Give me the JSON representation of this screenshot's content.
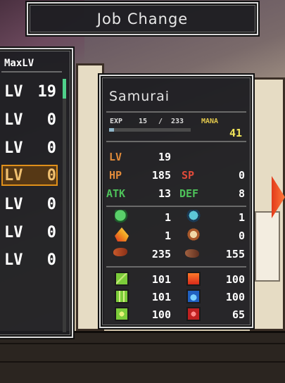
{
  "title_bar": {
    "title": "Job Change"
  },
  "level_list": {
    "header": "MaxLV",
    "rows": [
      {
        "tag": "LV",
        "value": "19"
      },
      {
        "tag": "LV",
        "value": "0"
      },
      {
        "tag": "LV",
        "value": "0"
      },
      {
        "tag": "LV",
        "value": "0"
      },
      {
        "tag": "LV",
        "value": "0"
      },
      {
        "tag": "LV",
        "value": "0"
      },
      {
        "tag": "LV",
        "value": "0"
      }
    ]
  },
  "detail": {
    "job_name": "Samurai",
    "exp_label": "EXP",
    "exp_current": "15",
    "exp_separator": "/",
    "exp_max": "233",
    "exp_fraction": 0.064,
    "mana_label": "MANA",
    "mana_value": "41",
    "stats": {
      "lv_label": "LV",
      "lv_value": "19",
      "hp_label": "HP",
      "hp_value": "185",
      "sp_label": "SP",
      "sp_value": "0",
      "atk_label": "ATK",
      "atk_value": "13",
      "def_label": "DEF",
      "def_value": "8"
    },
    "equipment": [
      {
        "left_icon": "green-helmet-icon",
        "left_value": "1",
        "right_icon": "blue-helmet-icon",
        "right_value": "1"
      },
      {
        "left_icon": "fire-badge-icon",
        "left_value": "1",
        "right_icon": "coin-s-icon",
        "right_value": "0"
      },
      {
        "left_icon": "meat-icon",
        "left_value": "235",
        "right_icon": "dried-meat-icon",
        "right_value": "155"
      }
    ],
    "elements": [
      {
        "left_icon": "sword-element-icon",
        "left_value": "101",
        "right_icon": "fire-element-icon",
        "right_value": "100"
      },
      {
        "left_icon": "earth-spikes-element-icon",
        "left_value": "101",
        "right_icon": "water-drop-element-icon",
        "right_value": "100"
      },
      {
        "left_icon": "nature-element-icon",
        "left_value": "100",
        "right_icon": "red-rune-element-icon",
        "right_value": "65"
      }
    ]
  },
  "colors": {
    "lv_hp_label": "#e08a3a",
    "sp_label": "#e04a3a",
    "atk_def_label": "#4ec25a",
    "mana_value": "#f2e65a",
    "selection": "#e0901a",
    "scroll_thumb": "#4fd08a"
  }
}
